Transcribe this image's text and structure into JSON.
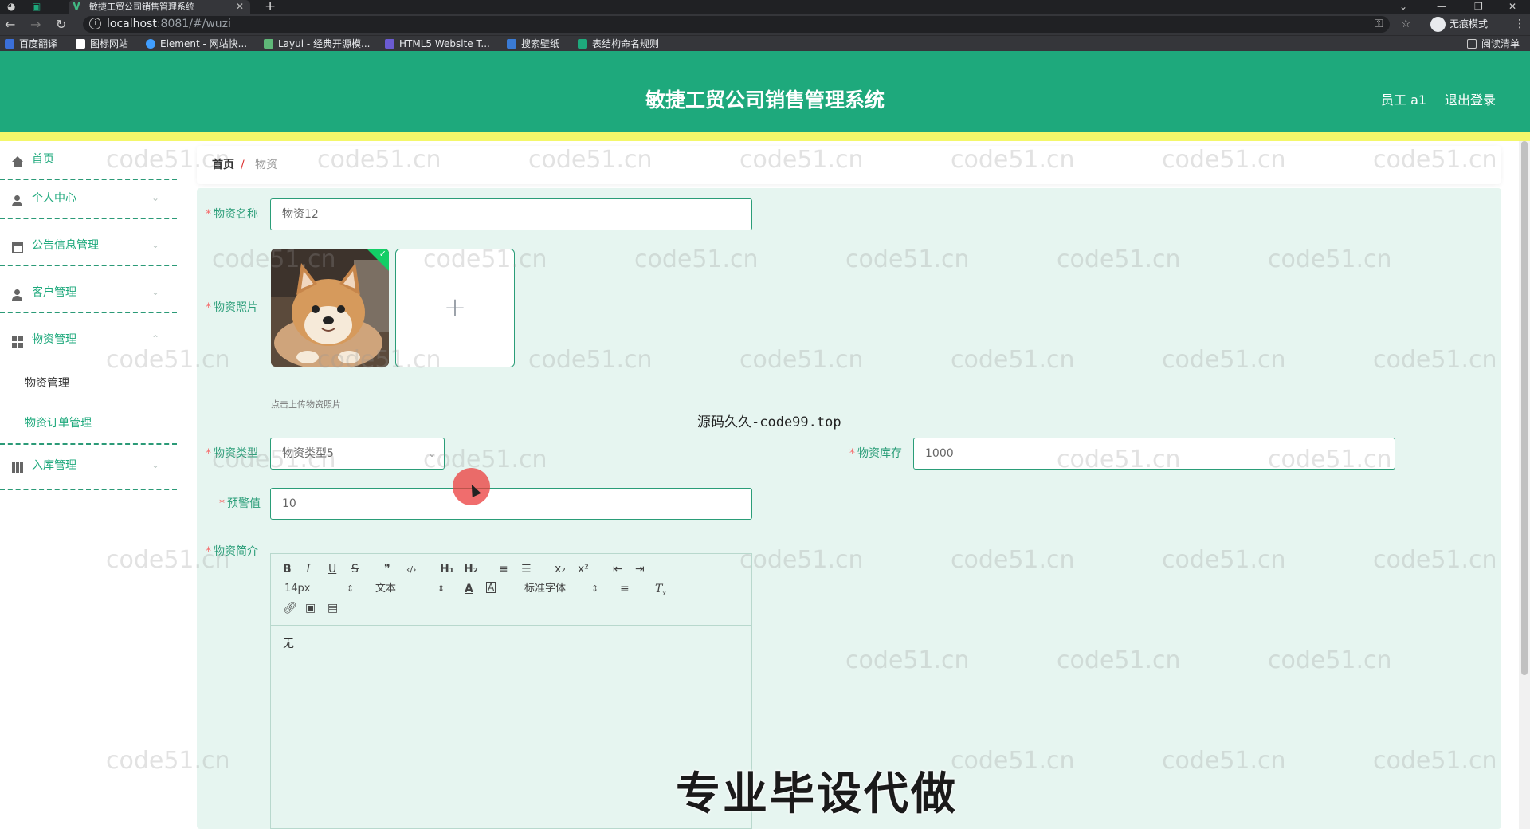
{
  "browser": {
    "tab_title": "敏捷工贸公司销售管理系统",
    "url_host": "localhost",
    "url_rest": ":8081/#/wuzi",
    "incognito_label": "无痕模式",
    "reading_list": "阅读清单",
    "bookmarks": [
      {
        "label": "百度翻译",
        "color": "#3b6fd8"
      },
      {
        "label": "图标网站",
        "color": "#ffffff"
      },
      {
        "label": "Element - 网站快...",
        "color": "#409eff"
      },
      {
        "label": "Layui - 经典开源模...",
        "color": "#5fb878"
      },
      {
        "label": "HTML5 Website T...",
        "color": "#6b5bd2"
      },
      {
        "label": "搜索壁纸",
        "color": "#3a7bd5"
      },
      {
        "label": "表结构命名规则",
        "color": "#1ea97c"
      }
    ]
  },
  "header": {
    "title": "敏捷工贸公司销售管理系统",
    "user": "员工 a1",
    "logout": "退出登录"
  },
  "sidebar": {
    "items": [
      {
        "label": "首页",
        "icon": "home-icon"
      },
      {
        "label": "个人中心",
        "icon": "user-icon"
      },
      {
        "label": "公告信息管理",
        "icon": "notice-icon"
      },
      {
        "label": "客户管理",
        "icon": "customer-icon"
      },
      {
        "label": "物资管理",
        "icon": "grid-icon"
      },
      {
        "label": "入库管理",
        "icon": "grid-icon"
      }
    ],
    "subitems": [
      "物资管理",
      "物资订单管理"
    ]
  },
  "breadcrumb": {
    "home": "首页",
    "separator": "/",
    "current": "物资"
  },
  "form": {
    "name_label": "物资名称",
    "name_value": "物资12",
    "photo_label": "物资照片",
    "photo_hint": "点击上传物资照片",
    "type_label": "物资类型",
    "type_value": "物资类型5",
    "stock_label": "物资库存",
    "stock_value": "1000",
    "warn_label": "预警值",
    "warn_value": "10",
    "intro_label": "物资简介",
    "required_mark": "*"
  },
  "editor": {
    "font_size": "14px",
    "text_type": "文本",
    "font_family": "标准字体",
    "content": "无",
    "toolbar_row1": [
      "B",
      "I",
      "U",
      "S",
      "❞",
      "‹/›",
      "H₁",
      "H₂",
      "≡",
      "☰",
      "x₂",
      "x²",
      "⇤",
      "⇥"
    ]
  },
  "overlays": {
    "source_text": "源码久久-code99.top",
    "big_text": "专业毕设代做",
    "watermark": "code51.cn"
  },
  "colors": {
    "primary": "#1ea97c",
    "accent_bar": "#f4f76a",
    "panel": "#e6f5f0"
  }
}
